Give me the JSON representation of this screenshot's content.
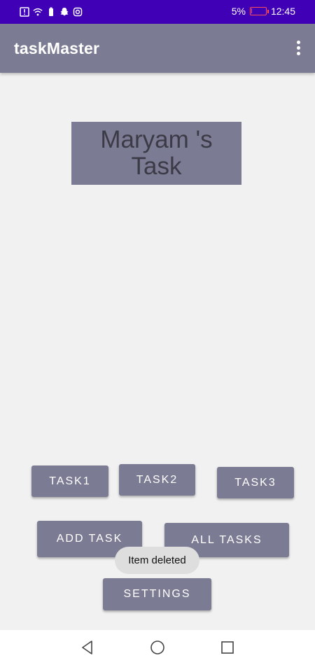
{
  "status_bar": {
    "battery_percent": "5%",
    "battery_level": 0.05,
    "time": "12:45",
    "icons": [
      "alert-icon",
      "wifi-icon",
      "battery-saver-icon",
      "snapchat-icon",
      "instagram-icon"
    ],
    "background": "#3f00b6"
  },
  "app_bar": {
    "title": "taskMaster",
    "overflow_icon": "more-vert-icon",
    "background": "#7b7c93"
  },
  "task_card": {
    "title": "Maryam 's Task"
  },
  "buttons": {
    "task1": "TASK1",
    "task2": "TASK2",
    "task3": "TASK3",
    "add_task": "ADD TASK",
    "all_tasks": "ALL TASKS",
    "settings": "SETTINGS"
  },
  "toast": {
    "message": "Item deleted"
  },
  "nav_bar": {
    "icons": [
      "back-icon",
      "home-icon",
      "recents-icon"
    ]
  }
}
